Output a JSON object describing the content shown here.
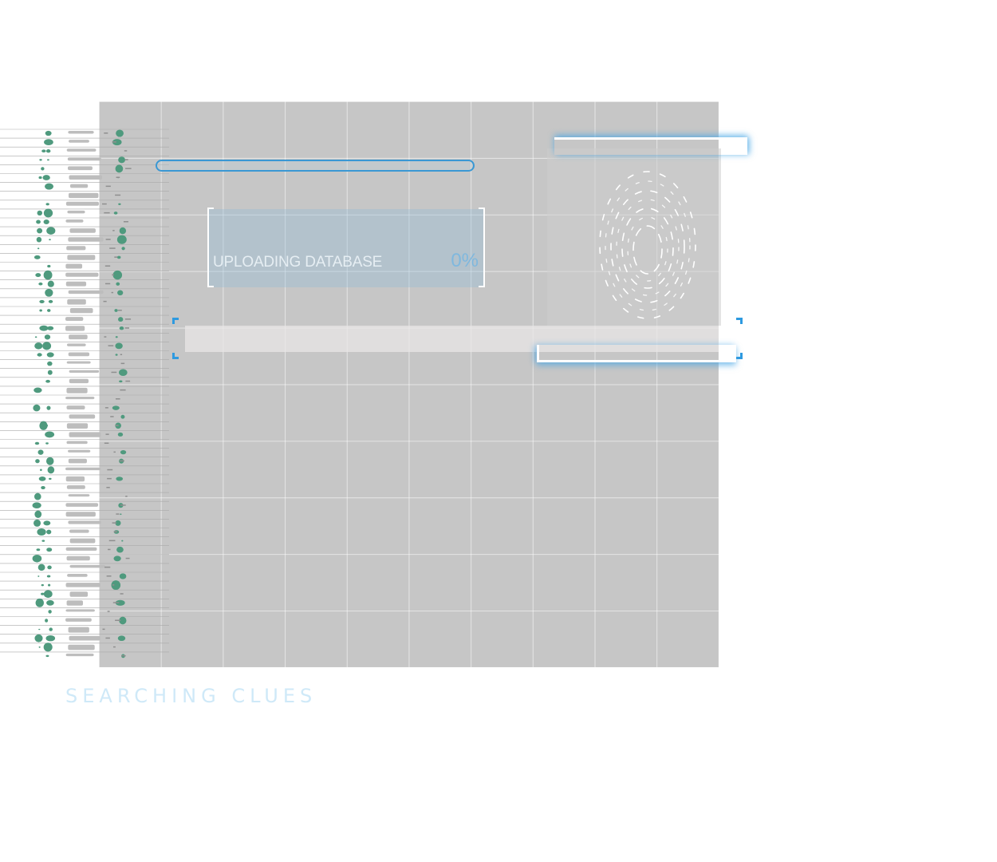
{
  "upload": {
    "label": "UPLOADING DATABASE",
    "percent_text": "0%",
    "progress": 0
  },
  "caption": "SEARCHING CLUES",
  "colors": {
    "panel_bg": "#c6c6c6",
    "accent_blue": "#3a98d4",
    "data_green": "#4f9a7e",
    "caption": "#cfe9f8"
  },
  "icons": {
    "fingerprint": "fingerprint-icon"
  }
}
